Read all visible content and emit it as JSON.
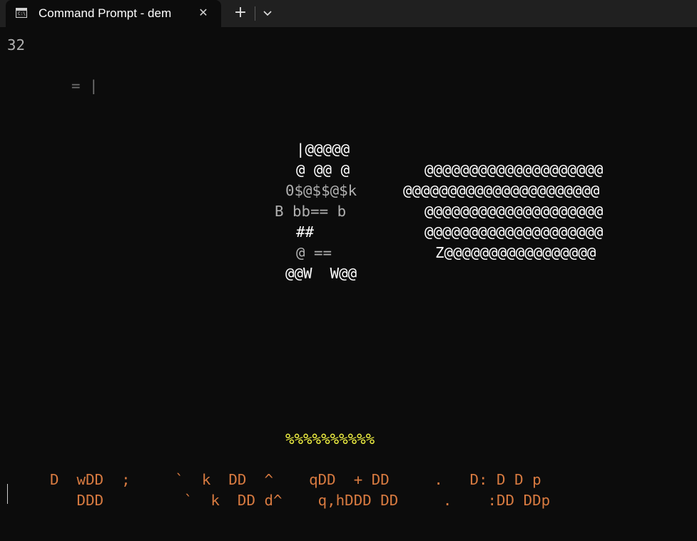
{
  "tab": {
    "title": "Command Prompt - dem",
    "close_glyph": "✕"
  },
  "new_tab_glyph": "+",
  "colors": {
    "background": "#0c0c0c",
    "tab_bar": "#202020",
    "yellow": "#f5f543",
    "orange": "#d77a40"
  },
  "terminal": {
    "counter": "32",
    "stray": "= |",
    "ascii_left": [
      "|@@@@@",
      "@ @@ @",
      "0$@$$@$k",
      "B bb== b",
      "##",
      "@ ==",
      "@@W  W@@"
    ],
    "ascii_right": [
      "@@@@@@@@@@@@@@@@@@@@",
      "@@@@@@@@@@@@@@@@@@@@@@",
      "@@@@@@@@@@@@@@@@@@@@",
      "@@@@@@@@@@@@@@@@@@@@",
      "Z@@@@@@@@@@@@@@@@@"
    ],
    "percent_row": "%%%%%%%%%%",
    "bottom_row_1": "D  wDD  ;     `  k  DD  ^    qDD  + DD     .   D: D D p",
    "bottom_row_2": "   DDD         `  k  DD d^    q,hDDD DD     .    :DD DDp"
  }
}
